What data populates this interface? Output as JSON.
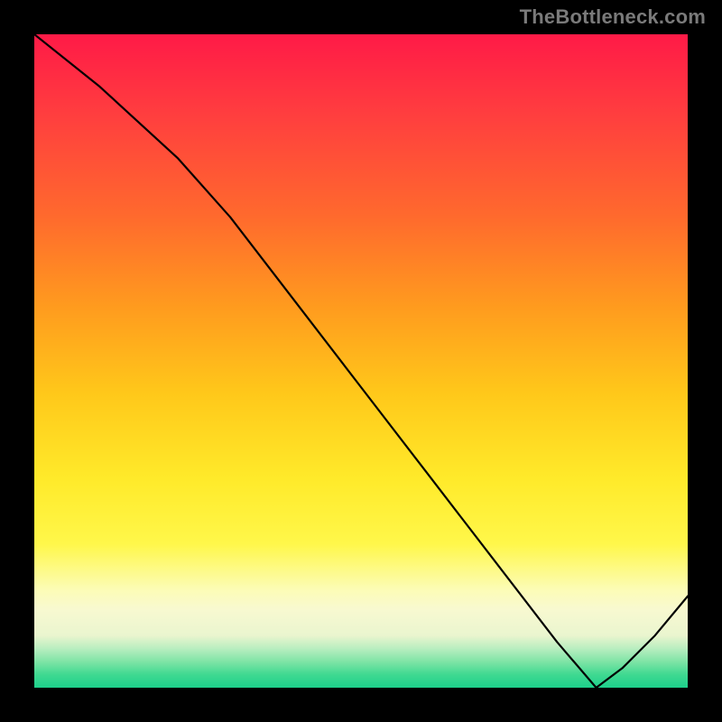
{
  "watermark": "TheBottleneck.com",
  "min_label": "",
  "chart_data": {
    "type": "line",
    "title": "",
    "xlabel": "",
    "ylabel": "",
    "xlim": [
      0,
      100
    ],
    "ylim": [
      0,
      100
    ],
    "series": [
      {
        "name": "curve",
        "x": [
          0,
          10,
          22,
          30,
          40,
          50,
          60,
          70,
          80,
          86,
          90,
          95,
          100
        ],
        "values": [
          100,
          92,
          81,
          72,
          59,
          46,
          33,
          20,
          7,
          0,
          3,
          8,
          14
        ]
      }
    ],
    "annotations": [
      {
        "name": "min-marker",
        "x": 86,
        "y": 0
      }
    ]
  }
}
